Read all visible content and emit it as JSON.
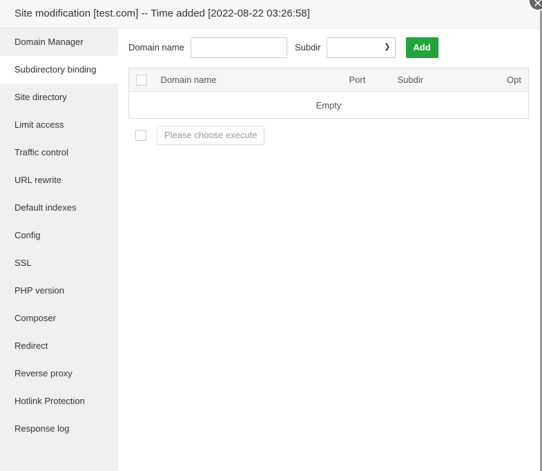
{
  "title": "Site modification [test.com] -- Time added [2022-08-22 03:26:58]",
  "close_icon": "close-icon",
  "sidebar": {
    "items": [
      {
        "label": "Domain Manager"
      },
      {
        "label": "Subdirectory binding"
      },
      {
        "label": "Site directory"
      },
      {
        "label": "Limit access"
      },
      {
        "label": "Traffic control"
      },
      {
        "label": "URL rewrite"
      },
      {
        "label": "Default indexes"
      },
      {
        "label": "Config"
      },
      {
        "label": "SSL"
      },
      {
        "label": "PHP version"
      },
      {
        "label": "Composer"
      },
      {
        "label": "Redirect"
      },
      {
        "label": "Reverse proxy"
      },
      {
        "label": "Hotlink Protection"
      },
      {
        "label": "Response log"
      }
    ],
    "active": "Subdirectory binding"
  },
  "form": {
    "domain_label": "Domain name",
    "domain_value": "",
    "subdir_label": "Subdir",
    "subdir_value": "",
    "add_label": "Add"
  },
  "table": {
    "columns": [
      "Domain name",
      "Port",
      "Subdir",
      "Opt"
    ],
    "empty": "Empty"
  },
  "footer": {
    "execute_label": "Please choose execute"
  },
  "colors": {
    "accent": "#20a53a"
  }
}
